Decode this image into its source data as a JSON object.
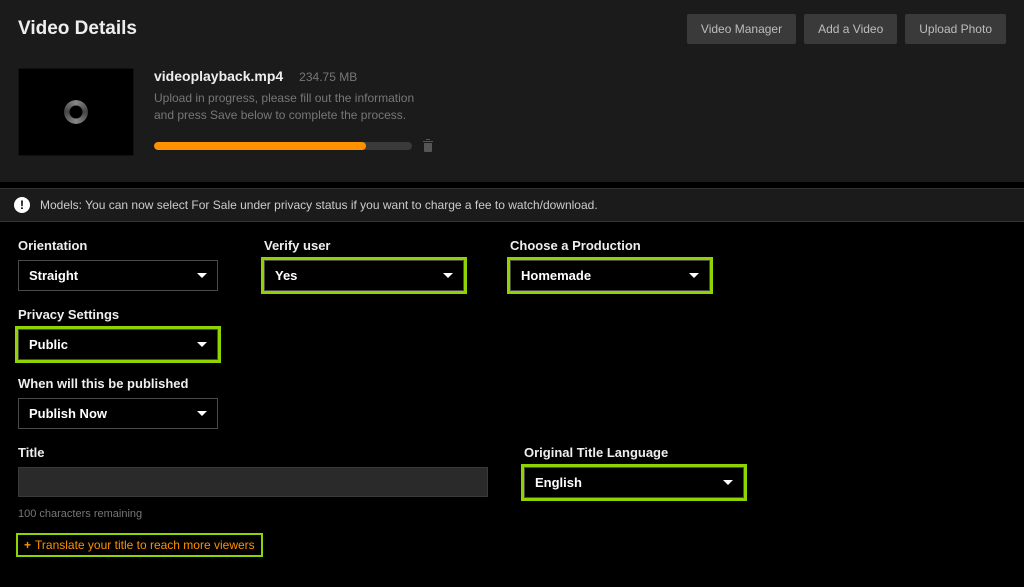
{
  "header": {
    "title": "Video Details",
    "buttons": {
      "manager": "Video Manager",
      "add": "Add a Video",
      "upload": "Upload Photo"
    }
  },
  "upload": {
    "filename": "videoplayback.mp4",
    "filesize": "234.75 MB",
    "desc": "Upload in progress, please fill out the information and press Save below to complete the process.",
    "progress_pct": 82
  },
  "banner": {
    "text": "Models: You can now select For Sale under privacy status if you want to charge a fee to watch/download."
  },
  "fields": {
    "orientation": {
      "label": "Orientation",
      "value": "Straight"
    },
    "verify": {
      "label": "Verify user",
      "value": "Yes"
    },
    "production": {
      "label": "Choose a Production",
      "value": "Homemade"
    },
    "privacy": {
      "label": "Privacy Settings",
      "value": "Public"
    },
    "publish": {
      "label": "When will this be published",
      "value": "Publish Now"
    },
    "title": {
      "label": "Title",
      "value": "",
      "hint": "100 characters remaining"
    },
    "language": {
      "label": "Original Title Language",
      "value": "English"
    }
  },
  "translate_link": "Translate your title to reach more viewers"
}
